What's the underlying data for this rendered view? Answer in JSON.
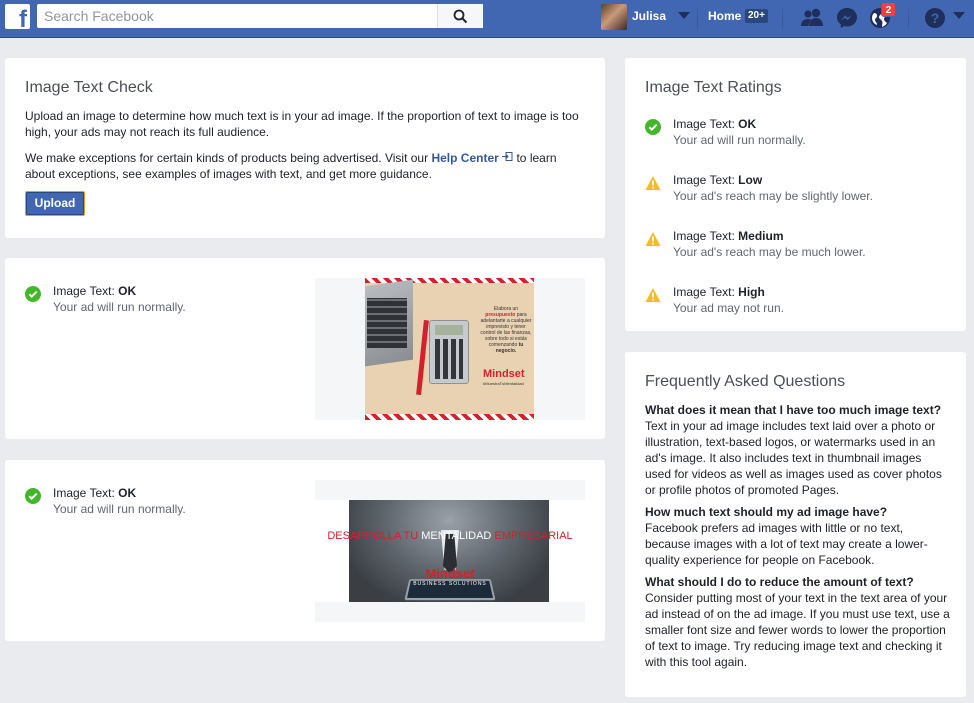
{
  "header": {
    "search_placeholder": "Search Facebook",
    "user_name": "Julisa",
    "home_label": "Home",
    "home_count": "20+",
    "notification_count": "2"
  },
  "check_card": {
    "title": "Image Text Check",
    "description": "Upload an image to determine how much text is in your ad image. If the proportion of text to image is too high, your ads may not reach its full audience.",
    "exceptions_before": "We make exceptions for certain kinds of products being advertised. Visit our ",
    "help_link": "Help Center",
    "exceptions_after": " to learn about exceptions, see examples of images with text, and get more guidance.",
    "upload_label": "Upload"
  },
  "results": [
    {
      "label": "Image Text: ",
      "rating": "OK",
      "message": "Your ad will run normally.",
      "image_text": {
        "line1": "Elabora un",
        "highlight": "presupuesto",
        "line2": "para",
        "rest": "adelantarte a cualquier imprevisto y tener control de las finanzas, sobre todo si estás comenzando",
        "strong": "tu negocio.",
        "brand": "Mindset",
        "tag": "#MuestraTuMentalidad"
      }
    },
    {
      "label": "Image Text: ",
      "rating": "OK",
      "message": "Your ad will run normally.",
      "image_text": {
        "headline_a": "DESARROLLA TU",
        "headline_b": "MENTALIDAD",
        "headline_c": "EMPRESARIAL",
        "brand": "Mindset",
        "brand_sub": "BUSINESS SOLUTIONS"
      }
    }
  ],
  "ratings_card": {
    "title": "Image Text Ratings",
    "items": [
      {
        "prefix": "Image Text: ",
        "level": "OK",
        "note": "Your ad will run normally.",
        "icon": "check-circle-icon"
      },
      {
        "prefix": "Image Text: ",
        "level": "Low",
        "note": "Your ad's reach may be slightly lower.",
        "icon": "warning-icon"
      },
      {
        "prefix": "Image Text: ",
        "level": "Medium",
        "note": "Your ad's reach may be much lower.",
        "icon": "warning-icon"
      },
      {
        "prefix": "Image Text: ",
        "level": "High",
        "note": "Your ad may not run.",
        "icon": "warning-icon"
      }
    ]
  },
  "faq_card": {
    "title": "Frequently Asked Questions",
    "items": [
      {
        "q": "What does it mean that I have too much image text?",
        "a": "Text in your ad image includes text laid over a photo or illustration, text-based logos, or watermarks used in an ad's image. It also includes text in thumbnail images used for videos as well as images used as cover photos or profile photos of promoted Pages."
      },
      {
        "q": "How much text should my ad image have?",
        "a": "Facebook prefers ad images with little or no text, because images with a lot of text may create a lower-quality experience for people on Facebook."
      },
      {
        "q": "What should I do to reduce the amount of text?",
        "a": "Consider putting most of your text in the text area of your ad instead of on the ad image. If you must use text, use a smaller font size and fewer words to lower the proportion of text to image. Try reducing image text and checking it with this tool again."
      }
    ]
  },
  "colors": {
    "brand_blue": "#4267b2",
    "ok_green": "#42b72a",
    "warn_yellow": "#f7b928",
    "accent_red": "#d6202d"
  }
}
